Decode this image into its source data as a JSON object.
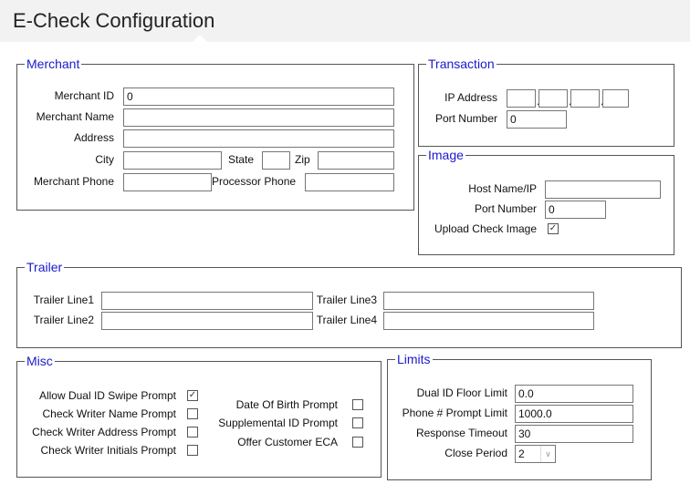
{
  "page": {
    "title": "E-Check Configuration"
  },
  "merchant": {
    "legend": "Merchant",
    "merchant_id_label": "Merchant ID",
    "merchant_id_value": "0",
    "merchant_name_label": "Merchant Name",
    "merchant_name_value": "",
    "address_label": "Address",
    "address_value": "",
    "city_label": "City",
    "city_value": "",
    "state_label": "State",
    "state_value": "",
    "zip_label": "Zip",
    "zip_value": "",
    "merchant_phone_label": "Merchant Phone",
    "merchant_phone_value": "",
    "processor_phone_label": "Processor Phone",
    "processor_phone_value": ""
  },
  "transaction": {
    "legend": "Transaction",
    "ip_address_label": "IP Address",
    "ip_octets": [
      "",
      "",
      "",
      ""
    ],
    "port_number_label": "Port Number",
    "port_number_value": "0"
  },
  "image": {
    "legend": "Image",
    "host_label": "Host Name/IP",
    "host_value": "",
    "port_number_label": "Port Number",
    "port_number_value": "0",
    "upload_label": "Upload Check Image",
    "upload_checked": true
  },
  "trailer": {
    "legend": "Trailer",
    "line1_label": "Trailer Line1",
    "line1_value": "",
    "line2_label": "Trailer Line2",
    "line2_value": "",
    "line3_label": "Trailer Line3",
    "line3_value": "",
    "line4_label": "Trailer Line4",
    "line4_value": ""
  },
  "misc": {
    "legend": "Misc",
    "allow_dual_id_label": "Allow Dual ID Swipe Prompt",
    "allow_dual_id_checked": true,
    "writer_name_label": "Check Writer Name Prompt",
    "writer_name_checked": false,
    "writer_address_label": "Check Writer Address Prompt",
    "writer_address_checked": false,
    "writer_initials_label": "Check Writer Initials Prompt",
    "writer_initials_checked": false,
    "dob_label": "Date Of Birth Prompt",
    "dob_checked": false,
    "supp_id_label": "Supplemental ID Prompt",
    "supp_id_checked": false,
    "offer_eca_label": "Offer Customer ECA",
    "offer_eca_checked": false
  },
  "limits": {
    "legend": "Limits",
    "dual_floor_label": "Dual ID Floor Limit",
    "dual_floor_value": "0.0",
    "phone_limit_label": "Phone # Prompt Limit",
    "phone_limit_value": "1000.0",
    "response_timeout_label": "Response Timeout",
    "response_timeout_value": "30",
    "close_period_label": "Close Period",
    "close_period_value": "2"
  },
  "colors": {
    "legend": "#1a1acc",
    "border": "#555555",
    "title_bar": "#f2f2f2"
  }
}
